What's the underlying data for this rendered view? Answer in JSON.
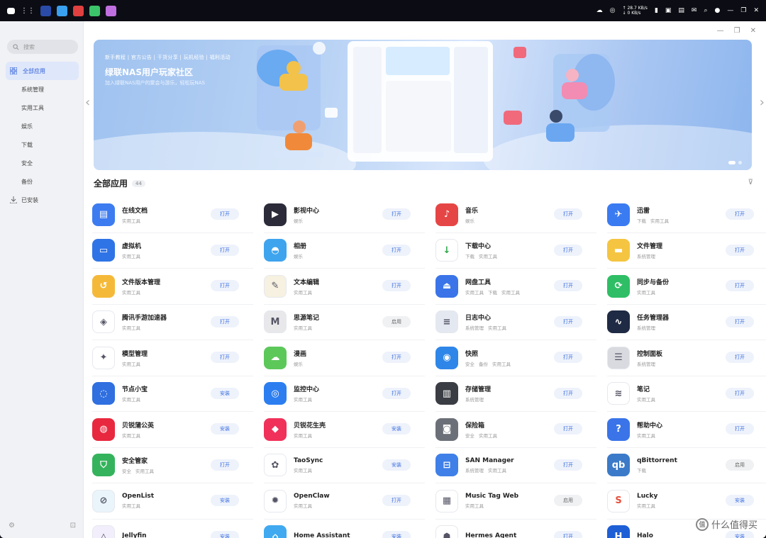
{
  "topbar": {
    "speed_up": "↑ 28.7 KB/s",
    "speed_down": "↓ 0 KB/s"
  },
  "sidebar": {
    "search_placeholder": "搜索",
    "items": [
      {
        "label": "全部应用",
        "active": true
      },
      {
        "label": "系统管理"
      },
      {
        "label": "实用工具"
      },
      {
        "label": "娱乐"
      },
      {
        "label": "下载"
      },
      {
        "label": "安全"
      },
      {
        "label": "备份"
      },
      {
        "label": "已安装"
      }
    ]
  },
  "banner": {
    "tags": "新手教程 | 官方公告 | 干货分享 | 玩机经验 | 福利活动",
    "title": "绿联NAS用户玩家社区",
    "subtitle": "加入绿联NAS用户的聚会与游乐，轻松玩NAS"
  },
  "section": {
    "title": "全部应用",
    "count": "44"
  },
  "apps": [
    {
      "name": "在线文档",
      "cats": [
        "实用工具"
      ],
      "action": "打开",
      "color": "#3d7cf0",
      "icon": "doc-icon"
    },
    {
      "name": "影视中心",
      "cats": [
        "娱乐"
      ],
      "action": "打开",
      "color": "#2b2b3a",
      "icon": "film-icon"
    },
    {
      "name": "音乐",
      "cats": [
        "娱乐"
      ],
      "action": "打开",
      "color": "#e64545",
      "icon": "music-icon"
    },
    {
      "name": "迅雷",
      "cats": [
        "下载",
        "实用工具"
      ],
      "action": "打开",
      "color": "#3b7bf2",
      "icon": "bird-icon"
    },
    {
      "name": "虚拟机",
      "cats": [
        "实用工具"
      ],
      "action": "打开",
      "color": "#2f74e6",
      "icon": "monitor-icon"
    },
    {
      "name": "相册",
      "cats": [
        "娱乐"
      ],
      "action": "打开",
      "color": "#3fa4ee",
      "icon": "photo-icon"
    },
    {
      "name": "下载中心",
      "cats": [
        "下载",
        "实用工具"
      ],
      "action": "打开",
      "color": "#ffffff",
      "icon": "download-icon"
    },
    {
      "name": "文件管理",
      "cats": [
        "系统管理"
      ],
      "action": "打开",
      "color": "#f5c542",
      "icon": "folder-icon"
    },
    {
      "name": "文件版本管理",
      "cats": [
        "实用工具"
      ],
      "action": "打开",
      "color": "#f5b93a",
      "icon": "version-icon"
    },
    {
      "name": "文本编辑",
      "cats": [
        "实用工具"
      ],
      "action": "打开",
      "color": "#f6f1e0",
      "icon": "notepad-icon"
    },
    {
      "name": "网盘工具",
      "cats": [
        "实用工具",
        "下载",
        "实用工具"
      ],
      "action": "打开",
      "color": "#3a74e8",
      "icon": "drive-icon"
    },
    {
      "name": "同步与备份",
      "cats": [
        "实用工具"
      ],
      "action": "打开",
      "color": "#2fbe65",
      "icon": "sync-icon"
    },
    {
      "name": "腾讯手游加速器",
      "cats": [
        "实用工具"
      ],
      "action": "打开",
      "color": "#ffffff",
      "icon": "accelerator-icon"
    },
    {
      "name": "思源笔记",
      "cats": [
        "实用工具"
      ],
      "action": "启用",
      "color": "#e8e8ea",
      "icon": "siyuan-icon"
    },
    {
      "name": "日志中心",
      "cats": [
        "系统管理",
        "实用工具"
      ],
      "action": "打开",
      "color": "#e4e8f0",
      "icon": "logs-icon"
    },
    {
      "name": "任务管理器",
      "cats": [
        "系统管理"
      ],
      "action": "打开",
      "color": "#1f2a44",
      "icon": "taskmgr-icon"
    },
    {
      "name": "模型管理",
      "cats": [
        "实用工具"
      ],
      "action": "打开",
      "color": "#ffffff",
      "icon": "model-icon"
    },
    {
      "name": "漫画",
      "cats": [
        "娱乐"
      ],
      "action": "打开",
      "color": "#5cc85a",
      "icon": "comic-icon"
    },
    {
      "name": "快照",
      "cats": [
        "安全",
        "备份",
        "实用工具"
      ],
      "action": "打开",
      "color": "#2e86e8",
      "icon": "snapshot-icon"
    },
    {
      "name": "控制面板",
      "cats": [
        "系统管理"
      ],
      "action": "打开",
      "color": "#d8dadf",
      "icon": "control-panel-icon"
    },
    {
      "name": "节点小宝",
      "cats": [
        "实用工具"
      ],
      "action": "安装",
      "color": "#2f6fe0",
      "icon": "node-icon"
    },
    {
      "name": "监控中心",
      "cats": [
        "实用工具"
      ],
      "action": "打开",
      "color": "#2c7ef0",
      "icon": "camera-icon"
    },
    {
      "name": "存储管理",
      "cats": [
        "系统管理"
      ],
      "action": "打开",
      "color": "#3a3d44",
      "icon": "storage-icon"
    },
    {
      "name": "笔记",
      "cats": [
        "实用工具"
      ],
      "action": "打开",
      "color": "#ffffff",
      "icon": "note-icon"
    },
    {
      "name": "贝锐蒲公英",
      "cats": [
        "实用工具"
      ],
      "action": "安装",
      "color": "#e8283f",
      "icon": "pgy-icon"
    },
    {
      "name": "贝锐花生壳",
      "cats": [
        "实用工具"
      ],
      "action": "安装",
      "color": "#f0315a",
      "icon": "peanut-icon"
    },
    {
      "name": "保险箱",
      "cats": [
        "安全",
        "实用工具"
      ],
      "action": "打开",
      "color": "#6b6f78",
      "icon": "safe-icon"
    },
    {
      "name": "帮助中心",
      "cats": [
        "实用工具"
      ],
      "action": "打开",
      "color": "#3a74e8",
      "icon": "help-icon"
    },
    {
      "name": "安全管家",
      "cats": [
        "安全",
        "实用工具"
      ],
      "action": "打开",
      "color": "#35b35c",
      "icon": "shield-icon"
    },
    {
      "name": "TaoSync",
      "cats": [
        "实用工具"
      ],
      "action": "安装",
      "color": "#ffffff",
      "icon": "taosync-icon"
    },
    {
      "name": "SAN Manager",
      "cats": [
        "系统管理",
        "实用工具"
      ],
      "action": "打开",
      "color": "#3f7fe8",
      "icon": "san-icon"
    },
    {
      "name": "qBittorrent",
      "cats": [
        "下载"
      ],
      "action": "启用",
      "color": "#3b7ac8",
      "icon": "qbittorrent-icon"
    },
    {
      "name": "OpenList",
      "cats": [
        "实用工具"
      ],
      "action": "安装",
      "color": "#e9f5fb",
      "icon": "openlist-icon"
    },
    {
      "name": "OpenClaw",
      "cats": [
        "实用工具"
      ],
      "action": "打开",
      "color": "#ffffff",
      "icon": "openclaw-icon"
    },
    {
      "name": "Music Tag Web",
      "cats": [
        "实用工具"
      ],
      "action": "启用",
      "color": "#ffffff",
      "icon": "musictag-icon"
    },
    {
      "name": "Lucky",
      "cats": [
        "实用工具"
      ],
      "action": "安装",
      "color": "#ffffff",
      "icon": "lucky-icon"
    },
    {
      "name": "Jellyfin",
      "cats": [],
      "action": "安装",
      "color": "#f2eefc",
      "icon": "jellyfin-icon"
    },
    {
      "name": "Home Assistant",
      "cats": [],
      "action": "安装",
      "color": "#40a9f0",
      "icon": "home-icon"
    },
    {
      "name": "Hermes Agent",
      "cats": [],
      "action": "打开",
      "color": "#ffffff",
      "icon": "hermes-icon"
    },
    {
      "name": "Halo",
      "cats": [],
      "action": "安装",
      "color": "#1e5fd6",
      "icon": "halo-icon"
    }
  ],
  "watermark": "什么值得买"
}
